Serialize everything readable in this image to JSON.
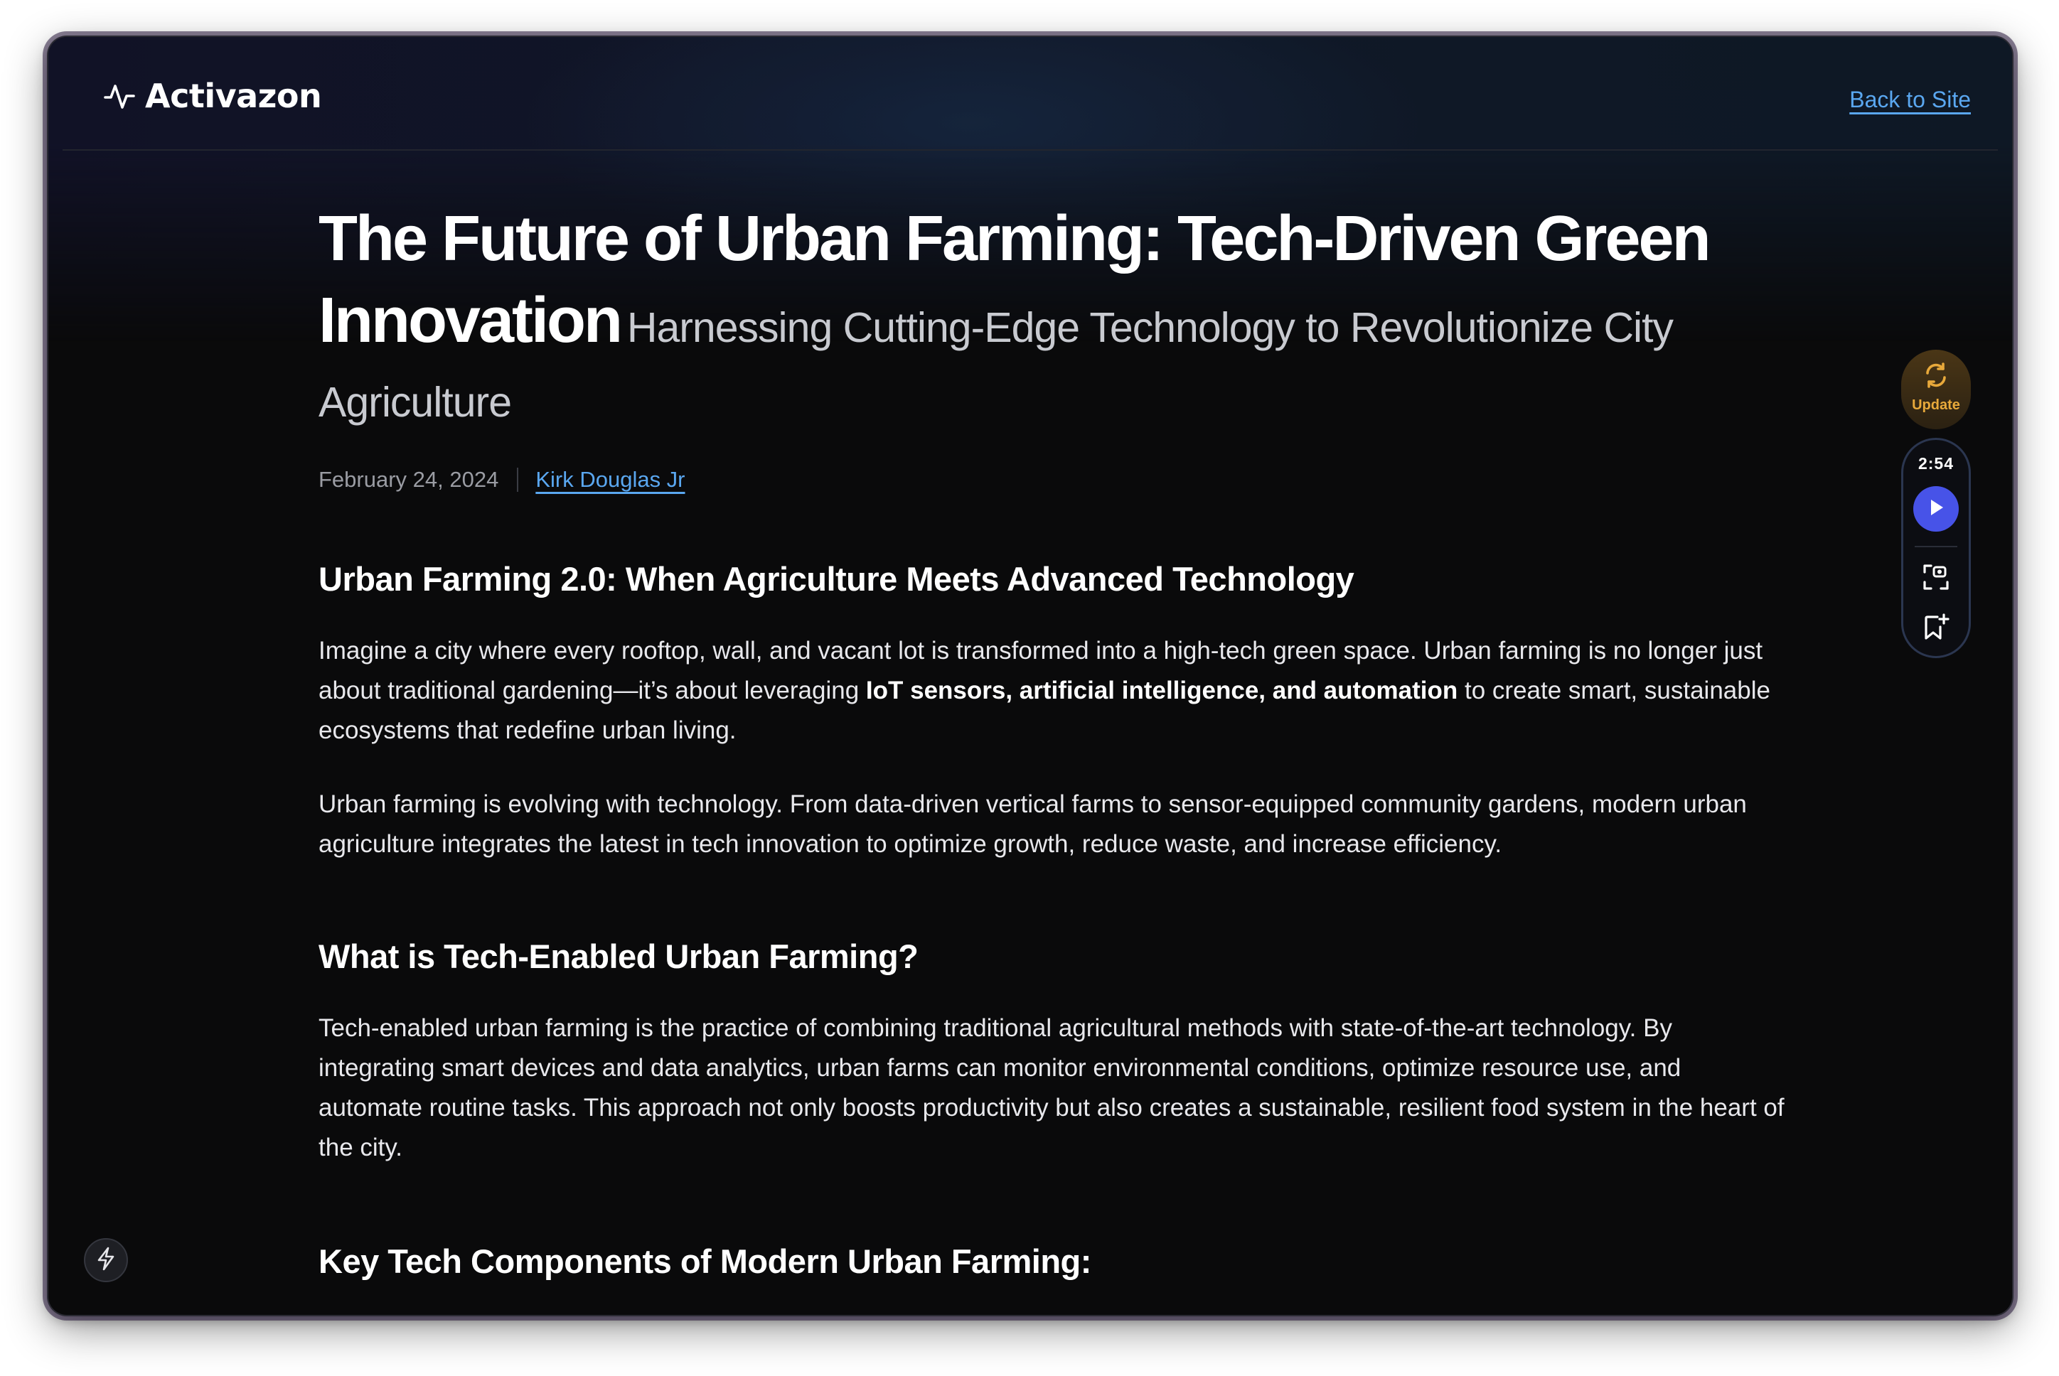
{
  "header": {
    "brand_name": "Activazon",
    "back_link": "Back to Site"
  },
  "article": {
    "title": "The Future of Urban Farming: Tech-Driven Green Innovation",
    "subtitle": "Harnessing Cutting-Edge Technology to Revolutionize City Agriculture",
    "date": "February 24, 2024",
    "author": "Kirk Douglas Jr",
    "sections": [
      {
        "heading": "Urban Farming 2.0: When Agriculture Meets Advanced Technology",
        "p1_before": "Imagine a city where every rooftop, wall, and vacant lot is transformed into a high-tech green space. Urban farming is no longer just about traditional gardening—it’s about leveraging ",
        "p1_bold": "IoT sensors, artificial intelligence, and automation",
        "p1_after": " to create smart, sustainable ecosystems that redefine urban living.",
        "p2": "Urban farming is evolving with technology. From data-driven vertical farms to sensor-equipped community gardens, modern urban agriculture integrates the latest in tech innovation to optimize growth, reduce waste, and increase efficiency."
      },
      {
        "heading": "What is Tech-Enabled Urban Farming?",
        "p1": "Tech-enabled urban farming is the practice of combining traditional agricultural methods with state-of-the-art technology. By integrating smart devices and data analytics, urban farms can monitor environmental conditions, optimize resource use, and automate routine tasks. This approach not only boosts productivity but also creates a sustainable, resilient food system in the heart of the city."
      },
      {
        "heading": "Key Tech Components of Modern Urban Farming:"
      }
    ]
  },
  "side_rail": {
    "update_label": "Update",
    "time": "2:54",
    "icons": [
      "refresh-icon",
      "play-icon",
      "screenshot-icon",
      "bookmark-add-icon"
    ]
  },
  "floating": {
    "icon": "bolt-icon"
  },
  "colors": {
    "background": "#0a0a0b",
    "link": "#5aa7f0",
    "update_accent": "#e8a93b",
    "play_button": "#4753e8"
  }
}
